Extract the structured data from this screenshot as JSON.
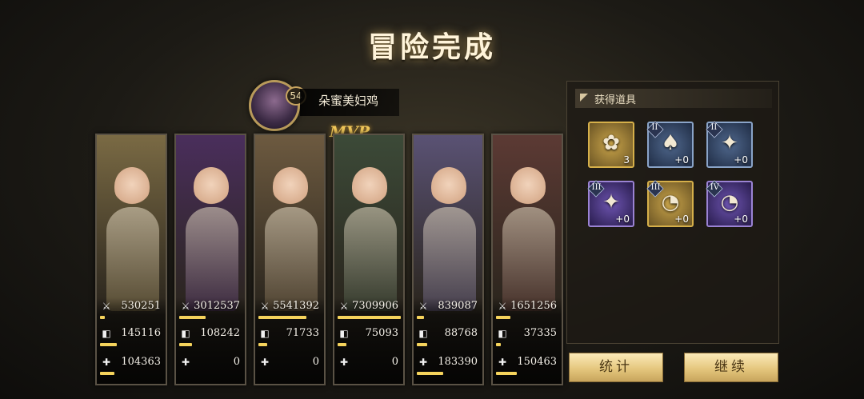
{
  "title": "冒险完成",
  "mvp": {
    "level": "54",
    "name": "朵蜜美妇鸡",
    "label": "MVP"
  },
  "heroes": [
    {
      "damage": "530251",
      "damage_fill": 0.07,
      "tank": "145116",
      "tank_fill": 0.25,
      "heal": "104363",
      "heal_fill": 0.22,
      "color": "#7a6a44"
    },
    {
      "damage": "3012537",
      "damage_fill": 0.4,
      "tank": "108242",
      "tank_fill": 0.2,
      "heal": "0",
      "heal_fill": 0.0,
      "color": "#4a2e5c"
    },
    {
      "damage": "5541392",
      "damage_fill": 0.73,
      "tank": "71733",
      "tank_fill": 0.13,
      "heal": "0",
      "heal_fill": 0.0,
      "color": "#6d5a40"
    },
    {
      "damage": "7309906",
      "damage_fill": 0.96,
      "tank": "75093",
      "tank_fill": 0.14,
      "heal": "0",
      "heal_fill": 0.0,
      "color": "#3c4a38"
    },
    {
      "damage": "839087",
      "damage_fill": 0.11,
      "tank": "88768",
      "tank_fill": 0.16,
      "heal": "183390",
      "heal_fill": 0.4,
      "color": "#5a5274"
    },
    {
      "damage": "1651256",
      "damage_fill": 0.22,
      "tank": "37335",
      "tank_fill": 0.07,
      "heal": "150463",
      "heal_fill": 0.32,
      "color": "#5c3a34"
    }
  ],
  "loot": {
    "title": "获得道具",
    "items": [
      {
        "name": "film-reel-icon",
        "glyph": "✿",
        "count": "3",
        "tier": "",
        "rarity": "gold"
      },
      {
        "name": "playing-cards-icon",
        "glyph": "♠",
        "count": "+0",
        "tier": "II",
        "rarity": "blue"
      },
      {
        "name": "sparkle-gem-icon",
        "glyph": "✦",
        "count": "+0",
        "tier": "II",
        "rarity": "blue"
      },
      {
        "name": "sparkle-gem-icon",
        "glyph": "✦",
        "count": "+0",
        "tier": "III",
        "rarity": "purple"
      },
      {
        "name": "gauge-lamp-icon",
        "glyph": "◔",
        "count": "+0",
        "tier": "III",
        "rarity": "gold"
      },
      {
        "name": "gauge-lamp-icon",
        "glyph": "◔",
        "count": "+0",
        "tier": "IV",
        "rarity": "purple"
      }
    ]
  },
  "buttons": {
    "stats": "统计",
    "continue": "继续"
  }
}
